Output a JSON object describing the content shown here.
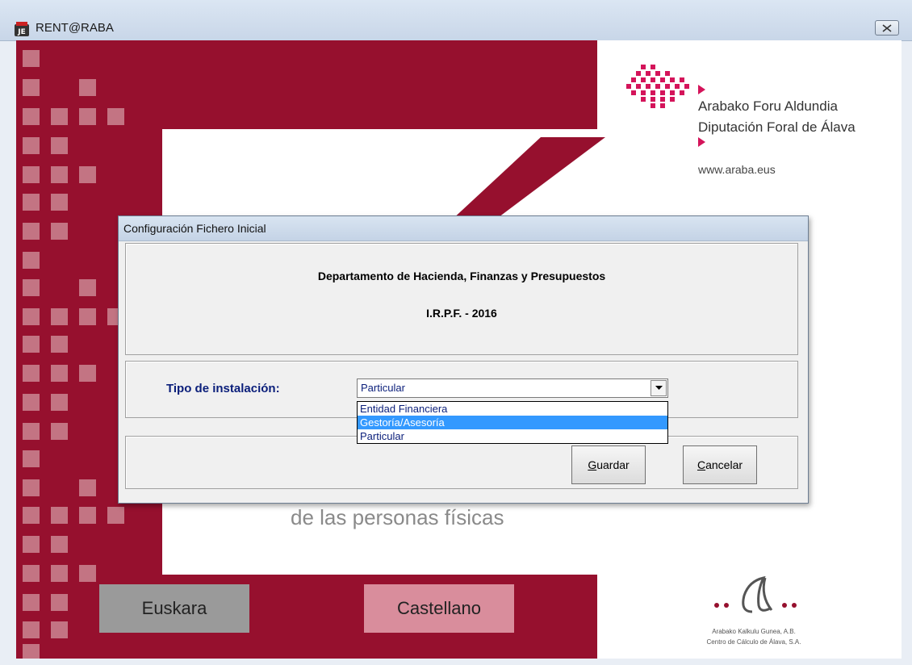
{
  "window": {
    "title": "RENT@RABA",
    "close_icon": "close-icon"
  },
  "splash": {
    "subtitle": "de las personas físicas",
    "buttons": {
      "euskara": "Euskara",
      "castellano": "Castellano"
    },
    "brand": {
      "line1": "Arabako Foru Aldundia",
      "line2": "Diputación Foral de Álava",
      "website": "www.araba.eus"
    },
    "footer_logo": {
      "line1": "Arabako Kalkulu Gunea, A.B.",
      "line2": "Centro de Cálculo de Álava, S.A."
    },
    "colors": {
      "maroon": "#96102e",
      "square": "#c37483",
      "pink_arrow": "#d4145a"
    }
  },
  "dialog": {
    "title": "Configuración Fichero Inicial",
    "department": "Departamento de Hacienda, Finanzas y Presupuestos",
    "irpf": "I.R.P.F. - 2016",
    "tipo_label": "Tipo de instalación:",
    "combo": {
      "value": "Particular",
      "options": [
        "Entidad Financiera",
        "Gestoría/Asesoría",
        "Particular"
      ],
      "highlighted": "Gestoría/Asesoría"
    },
    "buttons": {
      "guardar": "Guardar",
      "guardar_accel": "G",
      "guardar_rest": "uardar",
      "cancelar": "Cancelar",
      "cancelar_accel": "C",
      "cancelar_rest": "ancelar"
    }
  }
}
